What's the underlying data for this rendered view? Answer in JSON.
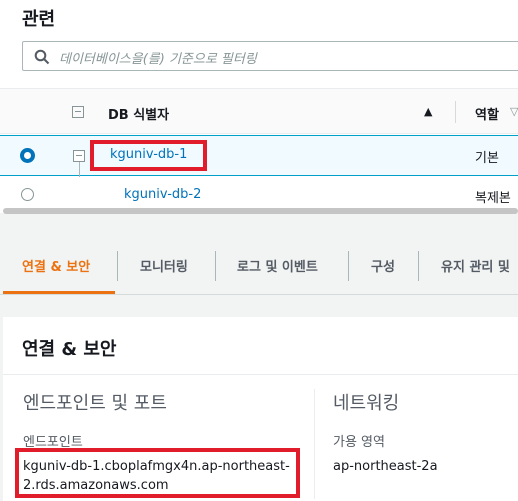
{
  "related": {
    "title": "관련",
    "search": {
      "placeholder": "데이터베이스을(를) 기준으로 필터링"
    },
    "table": {
      "columns": [
        "DB 식별자",
        "역할"
      ],
      "rows": [
        {
          "name": "kguniv-db-1",
          "role": "기본",
          "selected": true
        },
        {
          "name": "kguniv-db-2",
          "role": "복제본",
          "selected": false
        }
      ]
    }
  },
  "tabs": [
    {
      "label": "연결 & 보안",
      "active": true
    },
    {
      "label": "모니터링"
    },
    {
      "label": "로그 및 이벤트"
    },
    {
      "label": "구성"
    },
    {
      "label": "유지 관리 및"
    }
  ],
  "connectivity": {
    "title": "연결 & 보안",
    "endpoint_section": "엔드포인트 및 포트",
    "endpoint_label": "엔드포인트",
    "endpoint_line1": "kguniv-db-1.cboplafmgx4n.ap-northeast-",
    "endpoint_line2": "2.rds.amazonaws.com",
    "network_section": "네트워킹",
    "az_label": "가용 영역",
    "az_value": "ap-northeast-2a"
  },
  "colors": {
    "accent": "#ec7211",
    "link": "#0073bb",
    "highlight_border": "#e21d2b"
  }
}
